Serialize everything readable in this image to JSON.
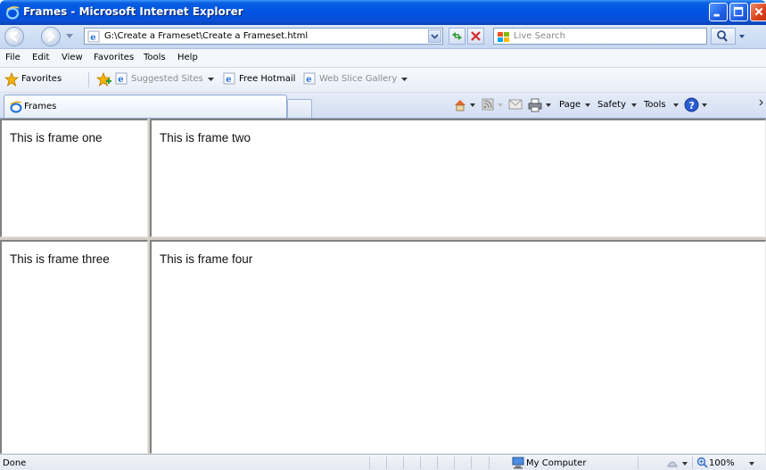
{
  "window": {
    "title": "Frames - Microsoft Internet Explorer"
  },
  "address_bar": {
    "url": "G:\\Create a Frameset\\Create a Frameset.html",
    "search_placeholder": "Live Search"
  },
  "menu": {
    "items": [
      "File",
      "Edit",
      "View",
      "Favorites",
      "Tools",
      "Help"
    ]
  },
  "favorites_bar": {
    "favorites_label": "Favorites",
    "suggested_sites": "Suggested Sites",
    "free_hotmail": "Free Hotmail",
    "web_slice_gallery": "Web Slice Gallery"
  },
  "tabs": {
    "active_tab": "Frames"
  },
  "command_bar": {
    "page": "Page",
    "safety": "Safety",
    "tools": "Tools"
  },
  "frames": {
    "one": "This is frame one",
    "two": "This is frame two",
    "three": "This is frame three",
    "four": "This is frame four"
  },
  "status_bar": {
    "status": "Done",
    "zone": "My Computer",
    "zoom": "100%"
  }
}
